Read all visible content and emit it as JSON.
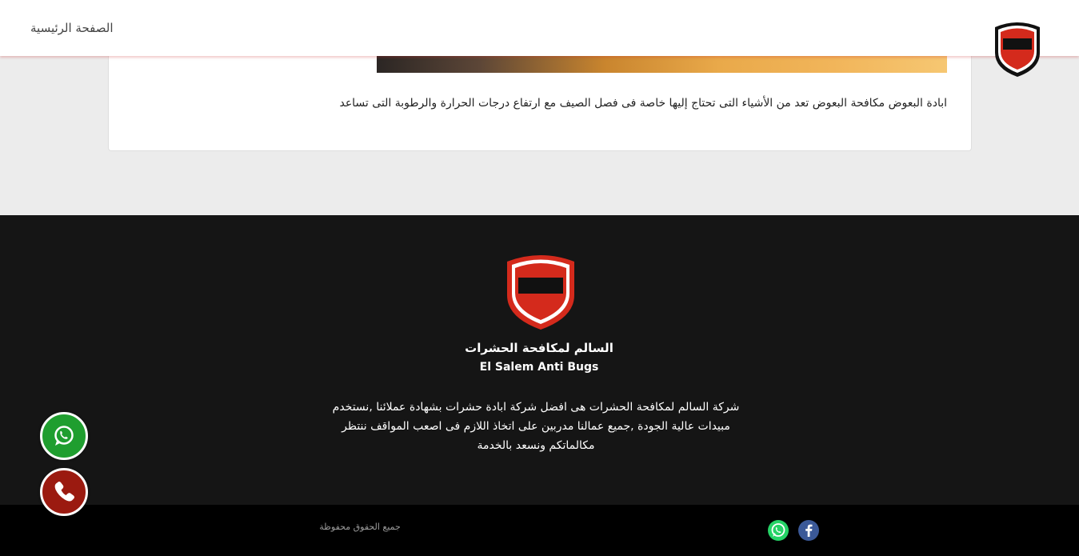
{
  "header": {
    "home_label": "الصفحة الرئيسية",
    "logo_text": "السالم"
  },
  "article": {
    "text": "ابادة البعوض مكافحة البعوض تعد من الأشياء التى تحتاج إليها خاصة فى فصل الصيف مع ارتفاع درجات الحرارة والرطوبة التى تساعد"
  },
  "footer": {
    "logo_text": "السالم",
    "brand_ar": "السالم لمكافحة الحشرات",
    "brand_en": "El Salem Anti Bugs",
    "about": "شركة السالم لمكافحة الحشرات هى افضل شركة ابادة حشرات بشهادة عملائنا ,نستخدم مبيدات عالية الجودة ,جميع عمالنا مدربين على اتخاذ اللازم فى اصعب المواقف ننتظر مكالماتكم ونسعد بالخدمة",
    "copyright": "جميع الحقوق محفوظة"
  },
  "social": [
    {
      "name": "whatsapp-icon",
      "color": "#25d366"
    },
    {
      "name": "facebook-icon",
      "color": "#3b5998"
    }
  ],
  "floating": {
    "whatsapp_color": "#1f9e2f",
    "call_color": "#9b1a10"
  },
  "colors": {
    "brand_red": "#d42a1c",
    "footer_bg": "#151515"
  }
}
